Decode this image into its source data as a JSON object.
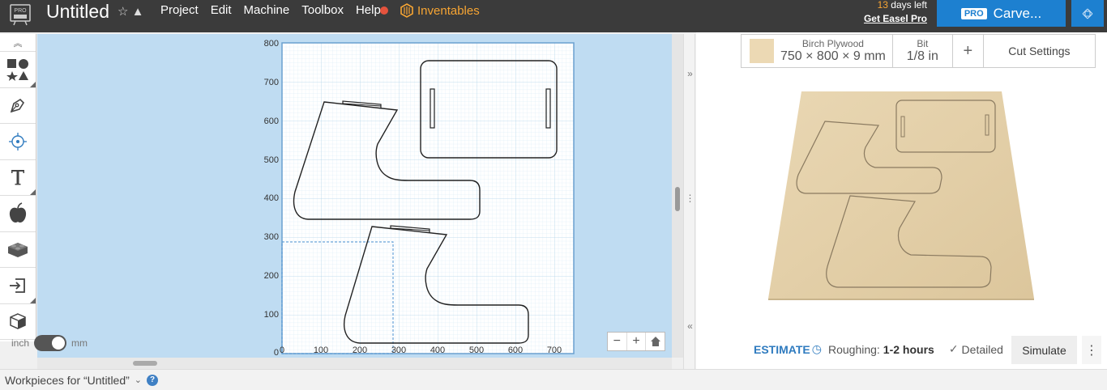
{
  "app": {
    "logo_badge": "PRO",
    "title": "Untitled",
    "menu": [
      "Project",
      "Edit",
      "Machine",
      "Toolbox",
      "Help"
    ],
    "inventables": "Inventables",
    "trial_days": "13",
    "trial_suffix": " days left",
    "get_pro": "Get Easel Pro",
    "carve_badge": "PRO",
    "carve_label": "Carve..."
  },
  "canvas": {
    "y_ticks": [
      "800",
      "700",
      "600",
      "500",
      "400",
      "300",
      "200",
      "100",
      "0"
    ],
    "x_ticks": [
      "0",
      "100",
      "200",
      "300",
      "400",
      "500",
      "600",
      "700"
    ],
    "units_left": "inch",
    "units_right": "mm",
    "zoom_out": "−",
    "zoom_in": "+"
  },
  "material": {
    "name": "Birch Plywood",
    "dims": "750 × 800 × 9 mm",
    "bit_label": "Bit",
    "bit_value": "1/8 in",
    "add": "+",
    "cut_settings": "Cut Settings",
    "swatch_color": "#ecd9b4"
  },
  "estimate": {
    "label": "ESTIMATE",
    "roughing_label": "Roughing:",
    "roughing_value": "1-2 hours",
    "detailed": "Detailed",
    "simulate": "Simulate",
    "more": "⋮"
  },
  "bottom": {
    "workpieces": "Workpieces for “Untitled”",
    "help": "?"
  },
  "colors": {
    "accent": "#1d80d0",
    "canvas_bg": "#bfdcf2",
    "topbar": "#3b3b3b",
    "inventables": "#f7a533"
  }
}
